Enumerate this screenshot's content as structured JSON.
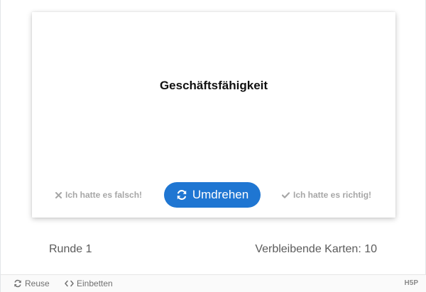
{
  "card": {
    "term": "Geschäftsfähigkeit"
  },
  "buttons": {
    "wrong_label": "Ich hatte es falsch!",
    "flip_label": "Umdrehen",
    "right_label": "Ich hatte es richtig!"
  },
  "status": {
    "round": "Runde 1",
    "remaining": "Verbleibende Karten: 10"
  },
  "footer": {
    "reuse_label": "Reuse",
    "embed_label": "Einbetten",
    "logo_text": "H5P"
  },
  "colors": {
    "accent": "#1f76d2",
    "muted": "#a6a6a6"
  },
  "icons": {
    "wrong": "close-icon",
    "flip": "refresh-icon",
    "right": "check-icon",
    "reuse": "reuse-icon",
    "embed": "code-icon"
  }
}
